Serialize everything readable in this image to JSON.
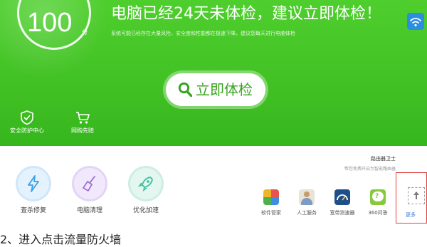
{
  "header": {
    "score": "100",
    "score_unit": "分",
    "headline": "电脑已经24天未体检，建议立即体检！",
    "subline": "系统可能已经存在大量风险，安全度和性能都在极速下降，建议您每天进行电脑体检",
    "check_button": "立即体检",
    "links": [
      {
        "label": "安全防护中心",
        "icon": "shield-icon"
      },
      {
        "label": "网购先赔",
        "icon": "cart-icon"
      }
    ]
  },
  "tools": [
    {
      "label": "查杀修复",
      "icon": "lightning-icon",
      "color": "#3aa0e8"
    },
    {
      "label": "电脑清理",
      "icon": "broom-icon",
      "color": "#9c6fd6"
    },
    {
      "label": "优化加速",
      "icon": "rocket-icon",
      "color": "#3bbf9a"
    }
  ],
  "guard": {
    "title": "路由器卫士",
    "subtitle": "帮您免费开启为智能路由器"
  },
  "apps": [
    {
      "label": "软件管家",
      "icon": "apps-grid-icon"
    },
    {
      "label": "人工服务",
      "icon": "person-icon"
    },
    {
      "label": "宽带测速器",
      "icon": "speedometer-icon"
    },
    {
      "label": "360问答",
      "icon": "qa-icon"
    }
  ],
  "more_label": "更多",
  "caption": "2、进入点击流量防火墙",
  "colors": {
    "hero_green": "#3fbe22",
    "button_text": "#3aa323",
    "highlight_red": "#e04040"
  }
}
